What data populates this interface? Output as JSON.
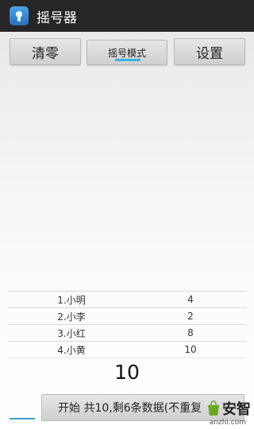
{
  "app": {
    "title": "摇号器"
  },
  "toolbar": {
    "clear_label": "清零",
    "mode_label": "摇号模式",
    "settings_label": "设置"
  },
  "list": {
    "rows": [
      {
        "name": "1.小明",
        "count": "4"
      },
      {
        "name": "2.小李",
        "count": "2"
      },
      {
        "name": "3.小红",
        "count": "8"
      },
      {
        "name": "4.小黄",
        "count": "10"
      }
    ]
  },
  "result": {
    "number": "10"
  },
  "start": {
    "label": "开始  共10,剩6条数据(不重复"
  },
  "watermark": {
    "brand": "安智",
    "url": "anzhi.com"
  },
  "colors": {
    "titlebar": "#262626",
    "accent": "#34b5e5",
    "watermark_green": "#6aa81e"
  }
}
